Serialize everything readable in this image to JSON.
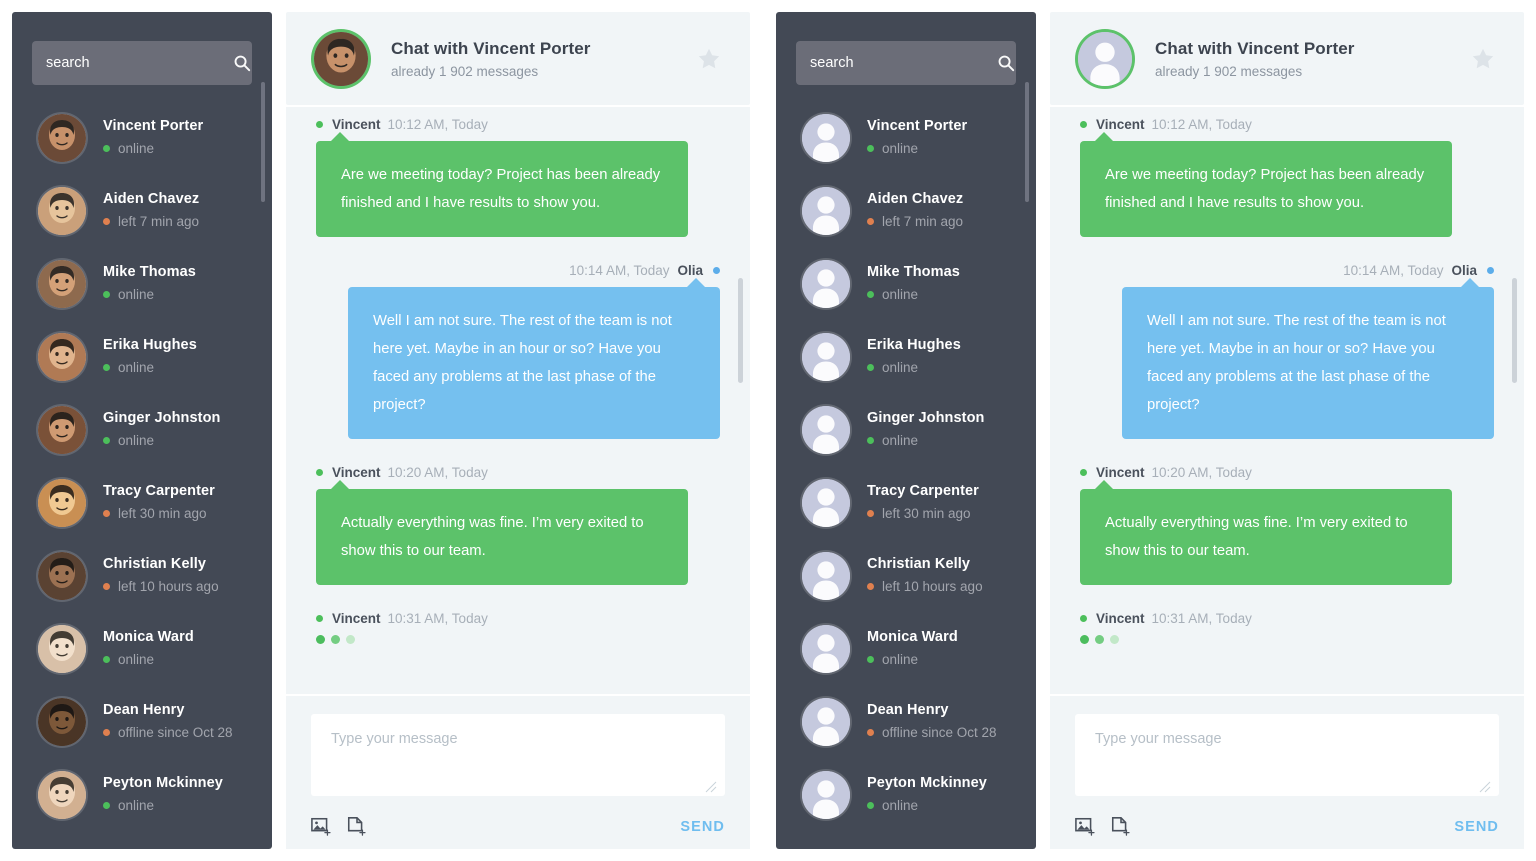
{
  "search": {
    "placeholder": "search",
    "icon": "search-icon"
  },
  "contacts": [
    {
      "name": "Vincent Porter",
      "status": "online",
      "state": "online"
    },
    {
      "name": "Aiden Chavez",
      "status": "left 7 min ago",
      "state": "away"
    },
    {
      "name": "Mike Thomas",
      "status": "online",
      "state": "online"
    },
    {
      "name": "Erika Hughes",
      "status": "online",
      "state": "online"
    },
    {
      "name": "Ginger Johnston",
      "status": "online",
      "state": "online"
    },
    {
      "name": "Tracy Carpenter",
      "status": "left 30 min ago",
      "state": "away"
    },
    {
      "name": "Christian Kelly",
      "status": "left 10 hours ago",
      "state": "away"
    },
    {
      "name": "Monica Ward",
      "status": "online",
      "state": "online"
    },
    {
      "name": "Dean Henry",
      "status": "offline since Oct 28",
      "state": "away"
    },
    {
      "name": "Peyton Mckinney",
      "status": "online",
      "state": "online"
    }
  ],
  "header": {
    "title": "Chat with Vincent Porter",
    "subtitle": "already 1 902 messages",
    "favorite_icon": "star-icon"
  },
  "messages": [
    {
      "kind": "ghost",
      "direction": "in",
      "who": "",
      "time": "",
      "text": ""
    },
    {
      "kind": "text",
      "direction": "in",
      "who": "Vincent",
      "time": "10:12 AM, Today",
      "text": "Are we meeting today? Project has been already finished and I have results to show you."
    },
    {
      "kind": "text",
      "direction": "out",
      "who": "Olia",
      "time": "10:14 AM, Today",
      "text": "Well I am not sure. The rest of the team is not here yet. Maybe  in an hour or so?  Have you faced any problems at the last phase of the project?"
    },
    {
      "kind": "text",
      "direction": "in",
      "who": "Vincent",
      "time": "10:20 AM, Today",
      "text": "Actually everything was fine. I’m very exited to show this to our team."
    },
    {
      "kind": "typing",
      "direction": "in",
      "who": "Vincent",
      "time": "10:31 AM, Today",
      "text": ""
    }
  ],
  "composer": {
    "placeholder": "Type your message",
    "send_label": "SEND",
    "image_icon": "add-image-icon",
    "file_icon": "add-file-icon"
  },
  "colors": {
    "sidebar_bg": "#434955",
    "search_bg": "#6b6d78",
    "panel_bg": "#f1f5f7",
    "bubble_in": "#5cc26a",
    "bubble_out": "#75c0ef",
    "accent_send": "#6fbdef",
    "status_online": "#4cbf5b",
    "status_away": "#e0804f"
  }
}
